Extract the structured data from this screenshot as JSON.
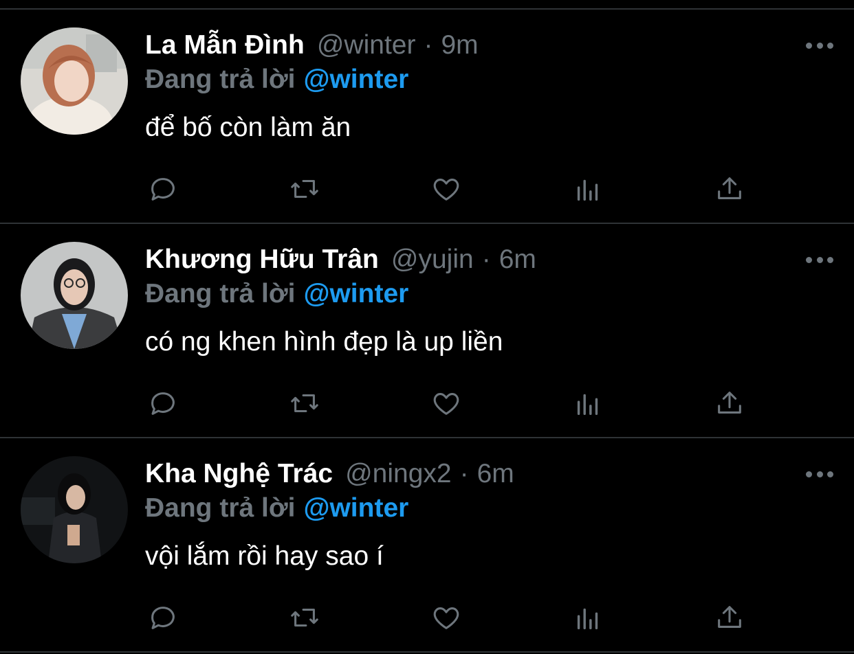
{
  "reply_prefix_label": "Đang trả lời",
  "tweets": [
    {
      "name": "La Mẫn Đình",
      "handle": "@winter",
      "time": "9m",
      "reply_to": "@winter",
      "text": "để bố còn làm ăn"
    },
    {
      "name": "Khương Hữu Trân",
      "handle": "@yujin",
      "time": "6m",
      "reply_to": "@winter",
      "text": "có ng khen hình đẹp là up liền"
    },
    {
      "name": "Kha Nghệ Trác",
      "handle": "@ningx2",
      "time": "6m",
      "reply_to": "@winter",
      "text": "vội lắm rồi hay sao í"
    }
  ],
  "separator": "·",
  "icons": [
    "reply-icon",
    "retweet-icon",
    "like-icon",
    "analytics-icon",
    "share-icon",
    "more-icon"
  ],
  "colors": {
    "background": "#000000",
    "name": "#ffffff",
    "muted": "#6e767d",
    "accent": "#1d9bf0",
    "divider": "#2f3336"
  }
}
